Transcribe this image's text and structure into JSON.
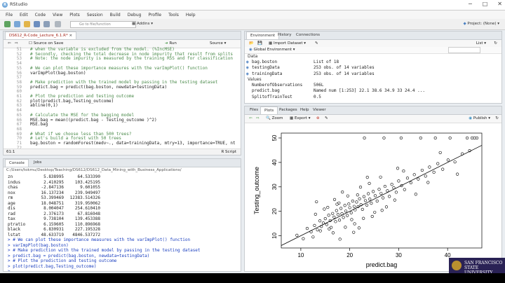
{
  "window": {
    "title": "RStudio",
    "controls": [
      "−",
      "□",
      "✕"
    ]
  },
  "menu": [
    "File",
    "Edit",
    "Code",
    "View",
    "Plots",
    "Session",
    "Build",
    "Debug",
    "Profile",
    "Tools",
    "Help"
  ],
  "toolbar": {
    "goto_placeholder": "Go to file/function",
    "addins": "Addins",
    "project": "Project: (None)"
  },
  "editor": {
    "tab": "DS612_R-Code_Lecture_6.1.R*",
    "source_on_save": "Source on Save",
    "run": "Run",
    "source": "Source",
    "status_left": "61:1",
    "status_right": "R Script",
    "lines": [
      {
        "n": "51",
        "t": "# when the variable is excluded from the model. (%IncMSE)",
        "c": true
      },
      {
        "n": "52",
        "t": "# Secondly, checking the total decrease in node impurity that result from splits",
        "c": true
      },
      {
        "n": "53",
        "t": "# Note: the node impurity is measured by the training RSS and for classification",
        "c": true
      },
      {
        "n": "54",
        "t": "",
        "c": false
      },
      {
        "n": "55",
        "t": "# We can plot these importance measures with the varImpPlot() function",
        "c": true
      },
      {
        "n": "56",
        "t": "varImpPlot(bag.boston)",
        "c": false
      },
      {
        "n": "57",
        "t": "",
        "c": false
      },
      {
        "n": "58",
        "t": "# Make prediction with the trained model by passing in the testing dataset",
        "c": true
      },
      {
        "n": "59",
        "t": "predict.bag = predict(bag.boston, newdata=testingData)",
        "c": false
      },
      {
        "n": "60",
        "t": "",
        "c": false
      },
      {
        "n": "61",
        "t": "# Plot the prediction and testing outcome",
        "c": true
      },
      {
        "n": "62",
        "t": "plot(predict.bag,Testing_outcome)",
        "c": false
      },
      {
        "n": "63",
        "t": "abline(0,1)",
        "c": false
      },
      {
        "n": "64",
        "t": "",
        "c": false
      },
      {
        "n": "65",
        "t": "# Calculate the MSE for the bagging model",
        "c": true
      },
      {
        "n": "66",
        "t": "MSE.bag = mean((predict.bag - Testing_outcome )^2)",
        "c": false
      },
      {
        "n": "67",
        "t": "MSE.bag",
        "c": false
      },
      {
        "n": "68",
        "t": "",
        "c": false
      },
      {
        "n": "69",
        "t": "# What if we choose less than 500 trees?",
        "c": true
      },
      {
        "n": "70",
        "t": "# Let's build a forest with 50 trees",
        "c": true
      },
      {
        "n": "71",
        "t": "bag.boston = randomForest(medv~., data=trainingData, mtry=13, importance=TRUE, nt",
        "c": false
      },
      {
        "n": "72",
        "t": "",
        "c": false
      }
    ]
  },
  "console": {
    "tabs": [
      "Console",
      "Jobs"
    ],
    "path": "C:/Users/tokmu/Desktop/Teaching/DS612/DS612_Data_Mining_with_Business_Applications/",
    "table": [
      {
        "name": "zn",
        "a": "5.838995",
        "b": "64.533390"
      },
      {
        "name": "indus",
        "a": "2.410295",
        "b": "103.425195"
      },
      {
        "name": "chas",
        "a": "-2.847136",
        "b": "9.601055"
      },
      {
        "name": "nox",
        "a": "16.137234",
        "b": "239.949497"
      },
      {
        "name": "rm",
        "a": "53.399469",
        "b": "12383.514326"
      },
      {
        "name": "age",
        "a": "18.048751",
        "b": "319.950062"
      },
      {
        "name": "dis",
        "a": "8.004047",
        "b": "254.610410"
      },
      {
        "name": "rad",
        "a": "2.376173",
        "b": "67.816948"
      },
      {
        "name": "tax",
        "a": "9.738104",
        "b": "139.453388"
      },
      {
        "name": "ptratio",
        "a": "6.159605",
        "b": "110.896968"
      },
      {
        "name": "black",
        "a": "6.830931",
        "b": "227.195328"
      },
      {
        "name": "lstat",
        "a": "48.633719",
        "b": "4846.537272"
      }
    ],
    "commands": [
      "> # We can plot these importance measures with the varImpPlot() function",
      "> varImpPlot(bag.boston)",
      "> # Make prediction with the trained model by passing in the testing dataset",
      "> predict.bag = predict(bag.boston, newdata=testingData)",
      "> # Plot the prediction and testing outcome",
      "> plot(predict.bag,Testing_outcome)",
      ">"
    ]
  },
  "environment": {
    "tabs": [
      "Environment",
      "History",
      "Connections"
    ],
    "import": "Import Dataset",
    "list": "List",
    "scope": "Global Environment",
    "data_header": "Data",
    "values_header": "Values",
    "data": [
      {
        "name": "bag.boston",
        "val": "List of 18"
      },
      {
        "name": "testingData",
        "val": "253 obs. of 14 variables"
      },
      {
        "name": "trainingData",
        "val": "253 obs. of 14 variables"
      }
    ],
    "values": [
      {
        "name": "NumberofObservations",
        "val": "506L"
      },
      {
        "name": "predict.bag",
        "val": "Named num [1:253] 22.1 38.6 34.9 33 24.4 ..."
      },
      {
        "name": "SplitofTrainTest",
        "val": "0.5"
      }
    ]
  },
  "plots": {
    "tabs": [
      "Files",
      "Plots",
      "Packages",
      "Help",
      "Viewer"
    ],
    "zoom": "Zoom",
    "export": "Export",
    "publish": "Publish"
  },
  "chart_data": {
    "type": "scatter",
    "xlabel": "predict.bag",
    "ylabel": "Testing_outcome",
    "xlim": [
      6,
      47
    ],
    "ylim": [
      5,
      52
    ],
    "xticks": [
      10,
      20,
      30,
      40
    ],
    "yticks": [
      10,
      20,
      30,
      40,
      50
    ],
    "line": {
      "slope": 1,
      "intercept": 0
    },
    "x": [
      9.2,
      10.5,
      11.3,
      12.1,
      12.8,
      13.4,
      13.9,
      14.2,
      14.6,
      15.0,
      15.3,
      15.7,
      16.0,
      16.2,
      16.5,
      16.8,
      17.1,
      17.3,
      17.6,
      17.9,
      18.2,
      18.4,
      18.7,
      19.0,
      19.2,
      19.5,
      19.8,
      20.0,
      20.3,
      20.6,
      20.9,
      21.1,
      21.4,
      21.7,
      22.0,
      22.3,
      22.6,
      22.9,
      23.2,
      23.5,
      23.8,
      24.1,
      24.4,
      24.8,
      25.2,
      25.6,
      26.0,
      26.4,
      26.8,
      27.2,
      27.7,
      28.1,
      28.6,
      29.0,
      29.5,
      30.0,
      30.6,
      31.2,
      31.8,
      32.5,
      33.2,
      34.0,
      34.8,
      35.5,
      36.3,
      37.2,
      38.0,
      39.0,
      40.1,
      41.5,
      43.0,
      44.5,
      12.5,
      14.0,
      15.5,
      16.6,
      17.8,
      19.1,
      20.4,
      21.6,
      22.8,
      24.0,
      25.1,
      26.3,
      27.5,
      29.2,
      31.0,
      33.5,
      36.0,
      38.5,
      42.0,
      13.0,
      15.8,
      18.5,
      21.0,
      23.6,
      26.6,
      29.8,
      23.0,
      27.0,
      30.5,
      34.5,
      37.5,
      40.5,
      44.0,
      45.0,
      45.5,
      46.0,
      18.0,
      20.8,
      22.2,
      24.6,
      16.9,
      19.6,
      21.9,
      17.4,
      14.8,
      13.2
    ],
    "y": [
      10.2,
      8.8,
      13.0,
      11.6,
      14.2,
      12.4,
      16.1,
      13.8,
      15.2,
      17.0,
      14.6,
      18.4,
      16.2,
      13.4,
      19.1,
      17.6,
      15.8,
      20.3,
      18.7,
      16.4,
      21.2,
      19.0,
      17.5,
      22.4,
      20.1,
      18.3,
      23.0,
      21.5,
      19.4,
      24.2,
      22.0,
      20.6,
      23.8,
      21.9,
      25.1,
      22.7,
      20.8,
      26.0,
      24.4,
      22.5,
      27.2,
      25.0,
      23.3,
      28.1,
      26.4,
      24.2,
      29.0,
      27.3,
      25.5,
      30.2,
      28.4,
      26.1,
      31.0,
      29.6,
      27.8,
      32.4,
      30.5,
      28.9,
      33.6,
      31.7,
      35.0,
      33.2,
      36.8,
      34.4,
      38.1,
      36.0,
      39.5,
      37.2,
      41.0,
      40.2,
      43.5,
      44.8,
      9.5,
      12.0,
      21.6,
      11.2,
      23.4,
      13.5,
      16.6,
      26.7,
      17.1,
      31.4,
      19.6,
      34.0,
      21.8,
      24.6,
      36.5,
      27.0,
      31.8,
      44.0,
      35.2,
      18.8,
      12.8,
      27.9,
      14.9,
      33.9,
      20.4,
      37.6,
      50.0,
      50.0,
      50.0,
      50.0,
      50.0,
      50.0,
      50.0,
      50.0,
      50.0,
      50.0,
      8.6,
      11.4,
      29.9,
      17.9,
      24.8,
      26.3,
      13.2,
      22.9,
      20.9,
      23.9
    ]
  }
}
